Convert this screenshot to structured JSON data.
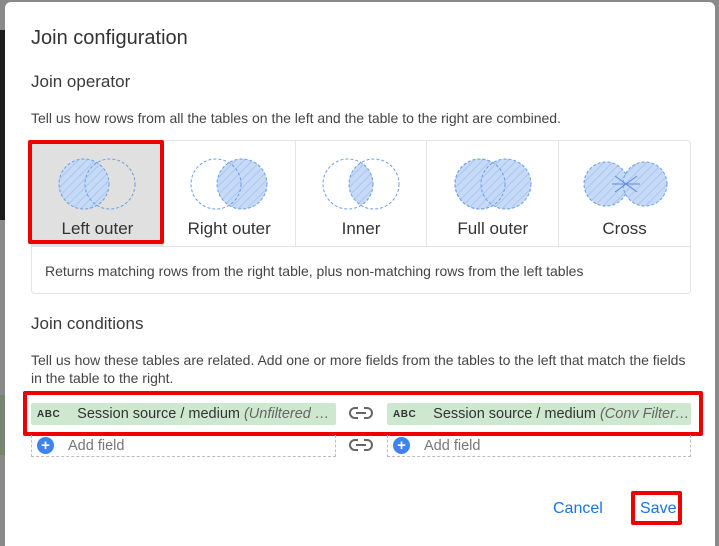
{
  "dialog": {
    "title": "Join configuration"
  },
  "join_operator": {
    "heading": "Join operator",
    "description": "Tell us how rows from all the tables on the left and the table to the right are combined.",
    "selected": "Left outer",
    "options": [
      {
        "label": "Left outer",
        "icon": "venn-left-outer-icon"
      },
      {
        "label": "Right outer",
        "icon": "venn-right-outer-icon"
      },
      {
        "label": "Inner",
        "icon": "venn-inner-icon"
      },
      {
        "label": "Full outer",
        "icon": "venn-full-outer-icon"
      },
      {
        "label": "Cross",
        "icon": "venn-cross-icon"
      }
    ],
    "selected_description": "Returns matching rows from the right table, plus non-matching rows from the left tables"
  },
  "join_conditions": {
    "heading": "Join conditions",
    "description": "Tell us how these tables are related. Add one or more fields from the tables to the left that match the fields in the table to the right.",
    "left_field": {
      "type_badge": "ABC",
      "name": "Session source / medium",
      "source": "(Unfiltered GA..."
    },
    "right_field": {
      "type_badge": "ABC",
      "name": "Session source / medium",
      "source": "(Conv Filtered..."
    },
    "add_field_label": "Add field",
    "add_icon": "+"
  },
  "actions": {
    "cancel_label": "Cancel",
    "save_label": "Save"
  },
  "colors": {
    "highlight": "#ee0000",
    "accent": "#1a73e8",
    "field_bg": "#cde8cf",
    "venn_fill": "#c6d9f7",
    "venn_stroke": "#6a9ee8"
  }
}
